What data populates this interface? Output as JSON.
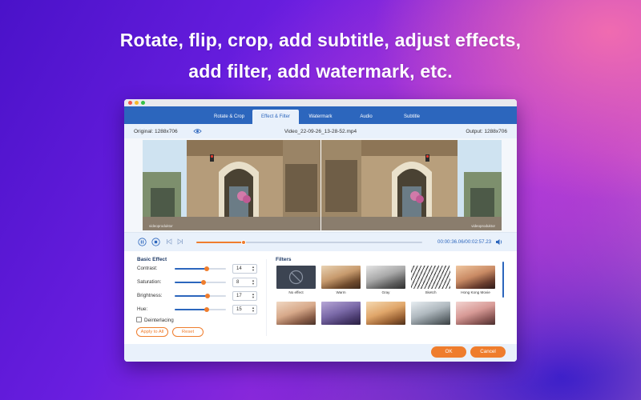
{
  "headline": {
    "line1": "Rotate, flip, crop, add subtitle, adjust effects,",
    "line2": "add filter, add watermark, etc."
  },
  "window": {
    "tabs": [
      {
        "label": "Rotate & Crop",
        "active": false
      },
      {
        "label": "Effect & Filter",
        "active": true
      },
      {
        "label": "Watermark",
        "active": false
      },
      {
        "label": "Audio",
        "active": false
      },
      {
        "label": "Subtitle",
        "active": false
      }
    ],
    "info": {
      "original": "Original: 1288x706",
      "filename": "Video_22-09-26_13-28-52.mp4",
      "output": "Output: 1288x706"
    },
    "preview": {
      "left_watermark": "videoproduktor",
      "right_watermark": "videoproduktor"
    },
    "player": {
      "progress": 0.21,
      "current_time": "00:00:36.06",
      "separator": "/",
      "total_time": "00:02:57.23"
    },
    "basic_effect": {
      "title": "Basic Effect",
      "rows": [
        {
          "label": "Contrast:",
          "value": "14",
          "level": 0.62
        },
        {
          "label": "Saturation:",
          "value": "8",
          "level": 0.57
        },
        {
          "label": "Brightness:",
          "value": "17",
          "level": 0.64
        },
        {
          "label": "Hue:",
          "value": "15",
          "level": 0.62
        }
      ],
      "deinterlacing": "Deinterlacing",
      "apply_all": "Apply to All",
      "reset": "Reset"
    },
    "filters": {
      "title": "Filters",
      "row1": [
        {
          "label": "No effect",
          "style": "none"
        },
        {
          "label": "Warm",
          "style": "warm"
        },
        {
          "label": "Gray",
          "style": "gray"
        },
        {
          "label": "Sketch",
          "style": "sketch"
        },
        {
          "label": "Hong Kong Movie",
          "style": "hk"
        }
      ],
      "row2": [
        {
          "label": "",
          "style": "warm2"
        },
        {
          "label": "",
          "style": "purple"
        },
        {
          "label": "",
          "style": "orange"
        },
        {
          "label": "",
          "style": "cool"
        },
        {
          "label": "",
          "style": "pink"
        }
      ]
    },
    "footer": {
      "ok": "OK",
      "cancel": "Cancel"
    }
  },
  "colors": {
    "accent": "#ef7d2d",
    "primary": "#2c66bd",
    "panel_bg": "#e9f1fb"
  }
}
